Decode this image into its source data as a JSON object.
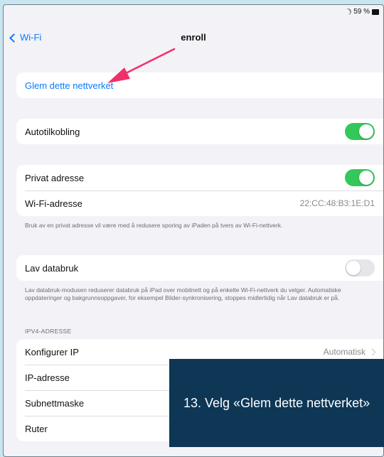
{
  "status_bar": {
    "battery_text": "59 %"
  },
  "nav": {
    "back_label": "Wi-Fi",
    "title": "enroll"
  },
  "forget": {
    "label": "Glem dette nettverket"
  },
  "auto_join": {
    "label": "Autotilkobling",
    "on": true
  },
  "private_address": {
    "label": "Privat adresse",
    "on": true
  },
  "wifi_address": {
    "label": "Wi-Fi-adresse",
    "value": "22:CC:48:B3:1E:D1"
  },
  "private_note": "Bruk av en privat adresse vil være med å redusere sporing av iPaden på tvers av Wi-Fi-nettverk.",
  "low_data": {
    "label": "Lav databruk",
    "on": false
  },
  "low_data_note": "Lav databruk-modusen reduserer databruk på iPad over mobilnett og på enkelte Wi-Fi-nettverk du velger. Automatiske oppdateringer og bakgrunnsoppgaver, for eksempel Bilder-synkronisering, stoppes midlertidig når Lav databruk er på.",
  "ipv4": {
    "header": "IPV4-ADRESSE",
    "configure_label": "Konfigurer IP",
    "configure_value": "Automatisk",
    "ip_label": "IP-adresse",
    "subnet_label": "Subnettmaske",
    "router_label": "Ruter"
  },
  "caption": "13. Velg «Glem dette nettverket»",
  "colors": {
    "accent": "#0a7aff",
    "toggle_on": "#34c759",
    "arrow": "#f0306a",
    "banner": "#0e3756"
  }
}
